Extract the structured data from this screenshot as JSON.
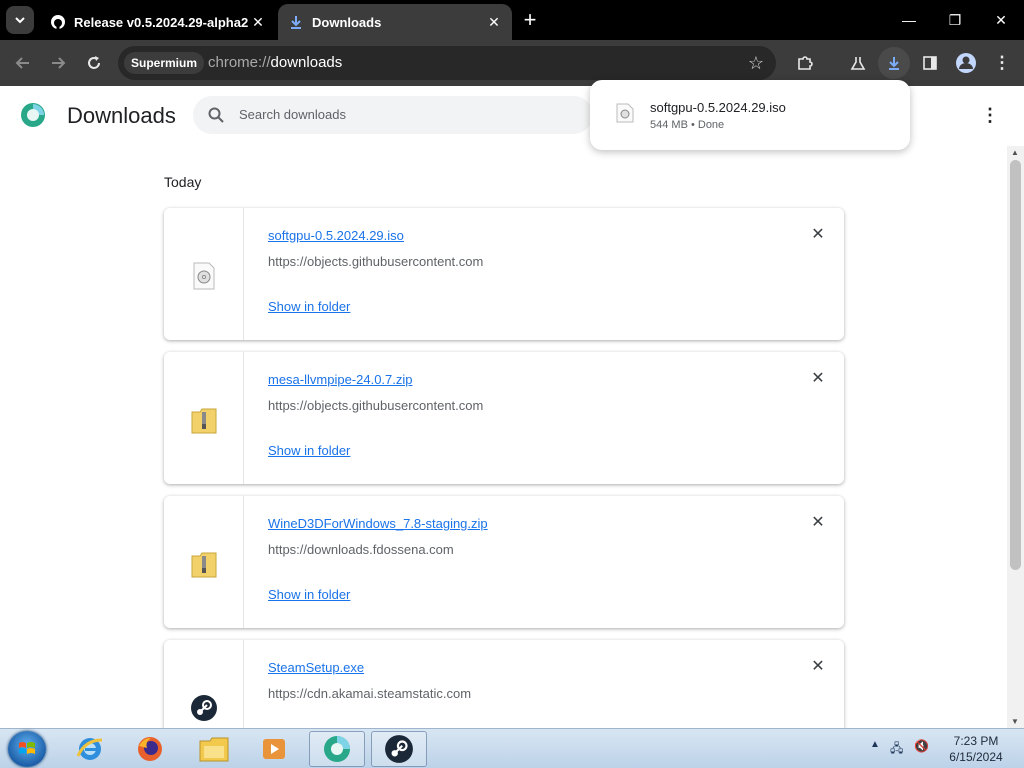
{
  "browser": {
    "tabs": [
      {
        "title": "Release v0.5.2024.29-alpha2 · ",
        "icon": "github-icon",
        "active": false
      },
      {
        "title": "Downloads",
        "icon": "download-icon",
        "active": true
      }
    ],
    "new_tab": "+",
    "window_controls": {
      "minimize": "—",
      "restore": "❐",
      "close": "✕"
    },
    "omnibox": {
      "chip": "Supermium",
      "scheme": "chrome://",
      "host": "downloads"
    }
  },
  "downloads_page": {
    "title": "Downloads",
    "search_placeholder": "Search downloads",
    "section": "Today",
    "items": [
      {
        "filename": "softgpu-0.5.2024.29.iso",
        "url": "https://objects.githubusercontent.com",
        "action": "Show in folder",
        "icon": "disc-image-icon"
      },
      {
        "filename": "mesa-llvmpipe-24.0.7.zip",
        "url": "https://objects.githubusercontent.com",
        "action": "Show in folder",
        "icon": "zip-folder-icon"
      },
      {
        "filename": "WineD3DForWindows_7.8-staging.zip",
        "url": "https://downloads.fdossena.com",
        "action": "Show in folder",
        "icon": "zip-folder-icon"
      },
      {
        "filename": "SteamSetup.exe",
        "url": "https://cdn.akamai.steamstatic.com",
        "action": "",
        "icon": "steam-icon"
      }
    ]
  },
  "download_bubble": {
    "filename": "softgpu-0.5.2024.29.iso",
    "status": "544 MB • Done"
  },
  "taskbar": {
    "apps": [
      "internet-explorer-icon",
      "firefox-icon",
      "file-explorer-icon",
      "media-player-icon",
      "supermium-icon",
      "steam-icon"
    ],
    "clock_time": "7:23 PM",
    "clock_date": "6/15/2024"
  },
  "colors": {
    "link": "#1a73e8",
    "tabbar": "#000000",
    "toolbar": "#3c3c3c"
  }
}
